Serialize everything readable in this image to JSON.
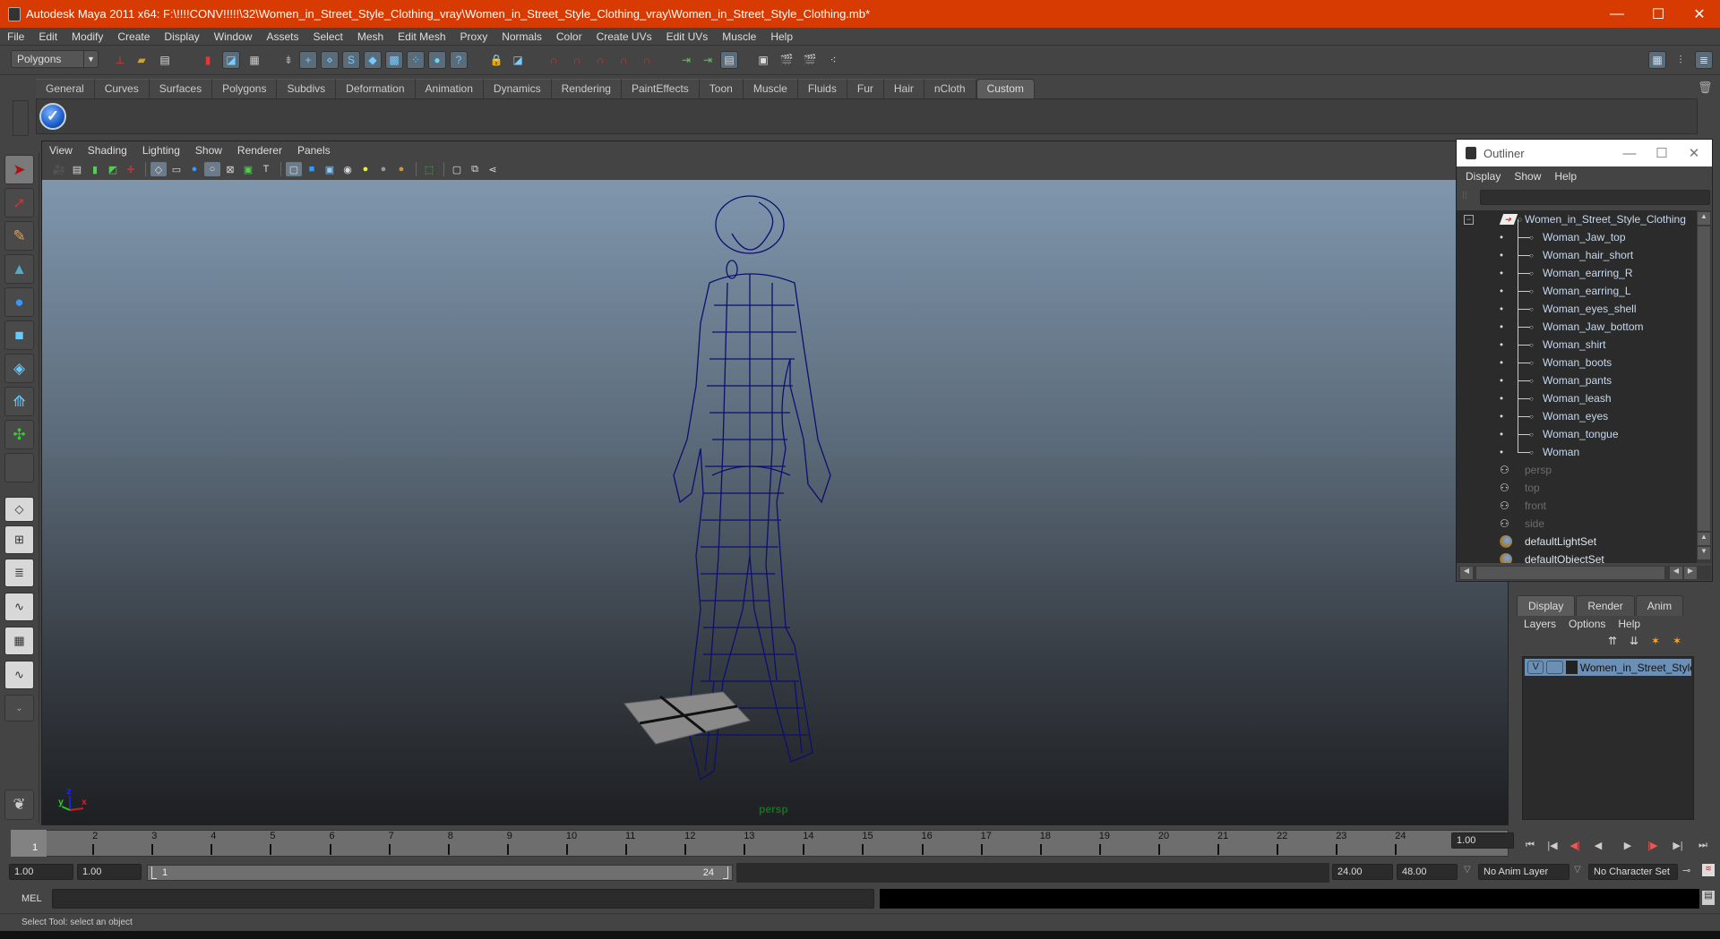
{
  "window": {
    "title": "Autodesk Maya 2011 x64: F:\\!!!!CONV!!!!!\\32\\Women_in_Street_Style_Clothing_vray\\Women_in_Street_Style_Clothing_vray\\Women_in_Street_Style_Clothing.mb*",
    "minimize": "—",
    "maximize": "☐",
    "close": "✕"
  },
  "menubar": [
    "File",
    "Edit",
    "Modify",
    "Create",
    "Display",
    "Window",
    "Assets",
    "Select",
    "Mesh",
    "Edit Mesh",
    "Proxy",
    "Normals",
    "Color",
    "Create UVs",
    "Edit UVs",
    "Muscle",
    "Help"
  ],
  "statusline": {
    "mode": "Polygons"
  },
  "shelf": {
    "tabs": [
      "General",
      "Curves",
      "Surfaces",
      "Polygons",
      "Subdivs",
      "Deformation",
      "Animation",
      "Dynamics",
      "Rendering",
      "PaintEffects",
      "Toon",
      "Muscle",
      "Fluids",
      "Fur",
      "Hair",
      "nCloth",
      "Custom"
    ],
    "active_tab": "Custom",
    "button_icon": "checkmark-icon"
  },
  "viewport": {
    "menu": [
      "View",
      "Shading",
      "Lighting",
      "Show",
      "Renderer",
      "Panels"
    ],
    "camera_label": "persp",
    "axis": {
      "x": "x",
      "y": "y",
      "z": "z"
    },
    "wire_color": "#0c0f6e"
  },
  "outliner": {
    "title": "Outliner",
    "menu": [
      "Display",
      "Show",
      "Help"
    ],
    "filter_value": "",
    "root": "Women_in_Street_Style_Clothing",
    "children": [
      "Woman_Jaw_top",
      "Woman_hair_short",
      "Woman_earring_R",
      "Woman_earring_L",
      "Woman_eyes_shell",
      "Woman_Jaw_bottom",
      "Woman_shirt",
      "Woman_boots",
      "Woman_pants",
      "Woman_leash",
      "Woman_eyes",
      "Woman_tongue",
      "Woman"
    ],
    "cameras": [
      "persp",
      "top",
      "front",
      "side"
    ],
    "sets": [
      "defaultLightSet",
      "defaultObjectSet"
    ]
  },
  "layers": {
    "tabs": [
      "Display",
      "Render",
      "Anim"
    ],
    "active_tab": "Display",
    "menu": [
      "Layers",
      "Options",
      "Help"
    ],
    "rows": [
      {
        "visible": "V",
        "name": "Women_in_Street_Style_"
      }
    ]
  },
  "timeline": {
    "ticks": [
      "1",
      "2",
      "3",
      "4",
      "5",
      "6",
      "7",
      "8",
      "9",
      "10",
      "11",
      "12",
      "13",
      "14",
      "15",
      "16",
      "17",
      "18",
      "19",
      "20",
      "21",
      "22",
      "23",
      "24"
    ],
    "current_frame_marker": "1",
    "current_time": "1.00",
    "playback": [
      "⏮",
      "|◀",
      "◀|",
      "◀",
      "▶",
      "|▶",
      "▶|",
      "⏭"
    ]
  },
  "range": {
    "start": "1.00",
    "playback_start": "1.00",
    "slider_start": "1",
    "slider_end": "24",
    "playback_end": "24.00",
    "end": "48.00",
    "anim_layer": "No Anim Layer",
    "character_set": "No Character Set"
  },
  "command": {
    "label": "MEL",
    "value": "",
    "result": ""
  },
  "helpline": "Select Tool: select an object"
}
